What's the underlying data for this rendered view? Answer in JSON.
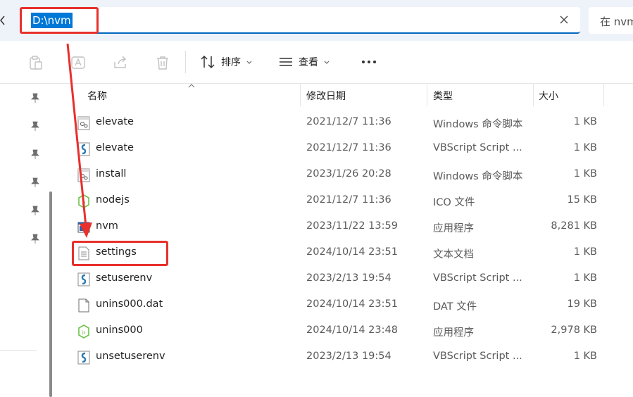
{
  "address_bar": {
    "path": "D:\\nvm"
  },
  "search": {
    "placeholder_partial": "在 nvm"
  },
  "toolbar": {
    "sort_label": "排序",
    "view_label": "查看"
  },
  "columns": {
    "name": "名称",
    "date": "修改日期",
    "type": "类型",
    "size": "大小"
  },
  "files": [
    {
      "name": "elevate",
      "date": "2021/12/7 11:36",
      "type": "Windows 命令脚本",
      "size": "1 KB",
      "icon": "batch-file-icon"
    },
    {
      "name": "elevate",
      "date": "2021/12/7 11:36",
      "type": "VBScript Script ...",
      "size": "1 KB",
      "icon": "vbscript-file-icon"
    },
    {
      "name": "install",
      "date": "2023/1/26 20:28",
      "type": "Windows 命令脚本",
      "size": "1 KB",
      "icon": "batch-file-icon"
    },
    {
      "name": "nodejs",
      "date": "2021/12/7 11:36",
      "type": "ICO 文件",
      "size": "15 KB",
      "icon": "node-icon"
    },
    {
      "name": "nvm",
      "date": "2023/11/22 13:59",
      "type": "应用程序",
      "size": "8,281 KB",
      "icon": "application-icon"
    },
    {
      "name": "settings",
      "date": "2024/10/14 23:51",
      "type": "文本文档",
      "size": "1 KB",
      "icon": "text-file-icon"
    },
    {
      "name": "setuserenv",
      "date": "2023/2/13 19:54",
      "type": "VBScript Script ...",
      "size": "1 KB",
      "icon": "vbscript-file-icon"
    },
    {
      "name": "unins000.dat",
      "date": "2024/10/14 23:51",
      "type": "DAT 文件",
      "size": "19 KB",
      "icon": "blank-file-icon"
    },
    {
      "name": "unins000",
      "date": "2024/10/14 23:48",
      "type": "应用程序",
      "size": "2,978 KB",
      "icon": "node-icon"
    },
    {
      "name": "unsetuserenv",
      "date": "2023/2/13 19:54",
      "type": "VBScript Script ...",
      "size": "1 KB",
      "icon": "vbscript-file-icon"
    }
  ],
  "colors": {
    "accent": "#0078d7",
    "annotation": "#e8302c",
    "node_green": "#6cc24a"
  }
}
